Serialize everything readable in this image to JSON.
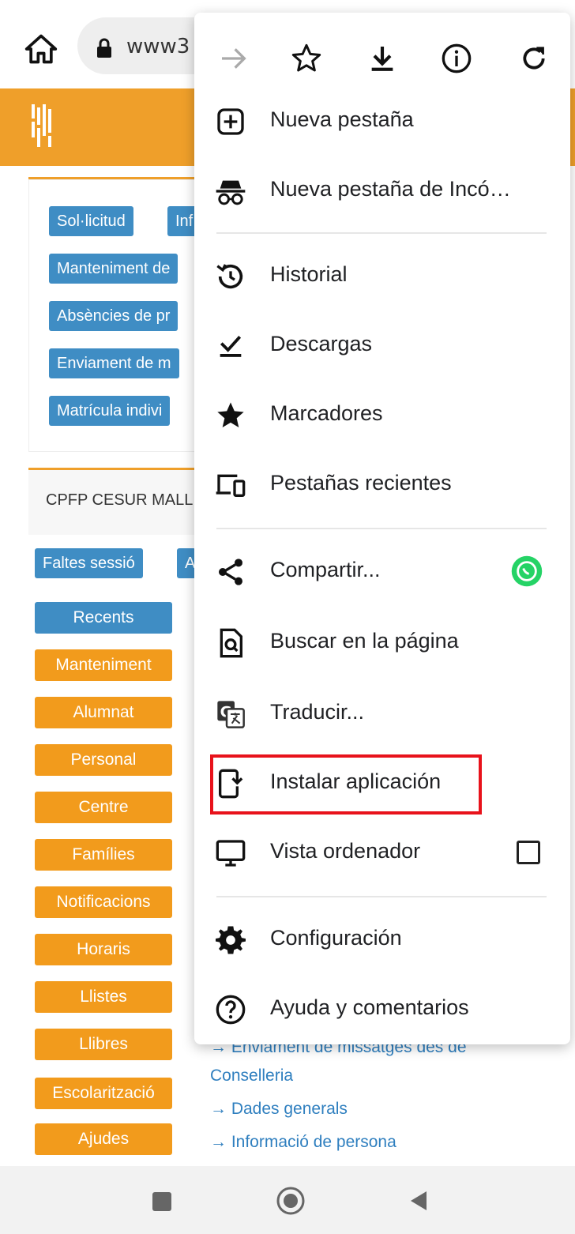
{
  "browser": {
    "url_text": "www3"
  },
  "page": {
    "tabs_chips": [
      {
        "label": "Sol·licitud"
      },
      {
        "label": "Inf"
      },
      {
        "label": "Manteniment de"
      },
      {
        "label": "Absències de pr"
      },
      {
        "label": "Enviament de m"
      },
      {
        "label": "Matrícula indivi"
      }
    ],
    "centre_name": "CPFP CESUR MALL",
    "session_chips": [
      {
        "label": "Faltes sessió"
      },
      {
        "label": "A"
      }
    ],
    "categories": [
      {
        "label": "Recents"
      },
      {
        "label": "Manteniment"
      },
      {
        "label": "Alumnat"
      },
      {
        "label": "Personal"
      },
      {
        "label": "Centre"
      },
      {
        "label": "Famílies"
      },
      {
        "label": "Notificacions"
      },
      {
        "label": "Horaris"
      },
      {
        "label": "Llistes"
      },
      {
        "label": "Llibres"
      },
      {
        "label": "Escolarització"
      },
      {
        "label": "Ajudes"
      }
    ],
    "links": [
      {
        "label": "→ Enviament de missatges des de"
      },
      {
        "label": "Conselleria"
      },
      {
        "label": "→ Dades generals"
      },
      {
        "label": "→ Informació de persona"
      }
    ]
  },
  "menu": {
    "items": [
      {
        "label": "Nueva pestaña",
        "icon": "new-tab-icon"
      },
      {
        "label": "Nueva pestaña de Incó…",
        "icon": "incognito-icon"
      },
      {
        "label": "Historial",
        "icon": "history-icon"
      },
      {
        "label": "Descargas",
        "icon": "downloads-icon"
      },
      {
        "label": "Marcadores",
        "icon": "bookmarks-icon"
      },
      {
        "label": "Pestañas recientes",
        "icon": "recent-tabs-icon"
      },
      {
        "label": "Compartir...",
        "icon": "share-icon"
      },
      {
        "label": "Buscar en la página",
        "icon": "find-in-page-icon"
      },
      {
        "label": "Traducir...",
        "icon": "translate-icon"
      },
      {
        "label": "Instalar aplicación",
        "icon": "install-app-icon"
      },
      {
        "label": "Vista ordenador",
        "icon": "desktop-view-icon"
      },
      {
        "label": "Configuración",
        "icon": "settings-icon"
      },
      {
        "label": "Ayuda y comentarios",
        "icon": "help-icon"
      }
    ]
  },
  "colors": {
    "header_orange": "#ef9f2a",
    "chip_blue": "#3f8dc4",
    "chip_orange": "#f29b1c",
    "highlight_red": "#e8121b",
    "whatsapp_green": "#25d366"
  }
}
